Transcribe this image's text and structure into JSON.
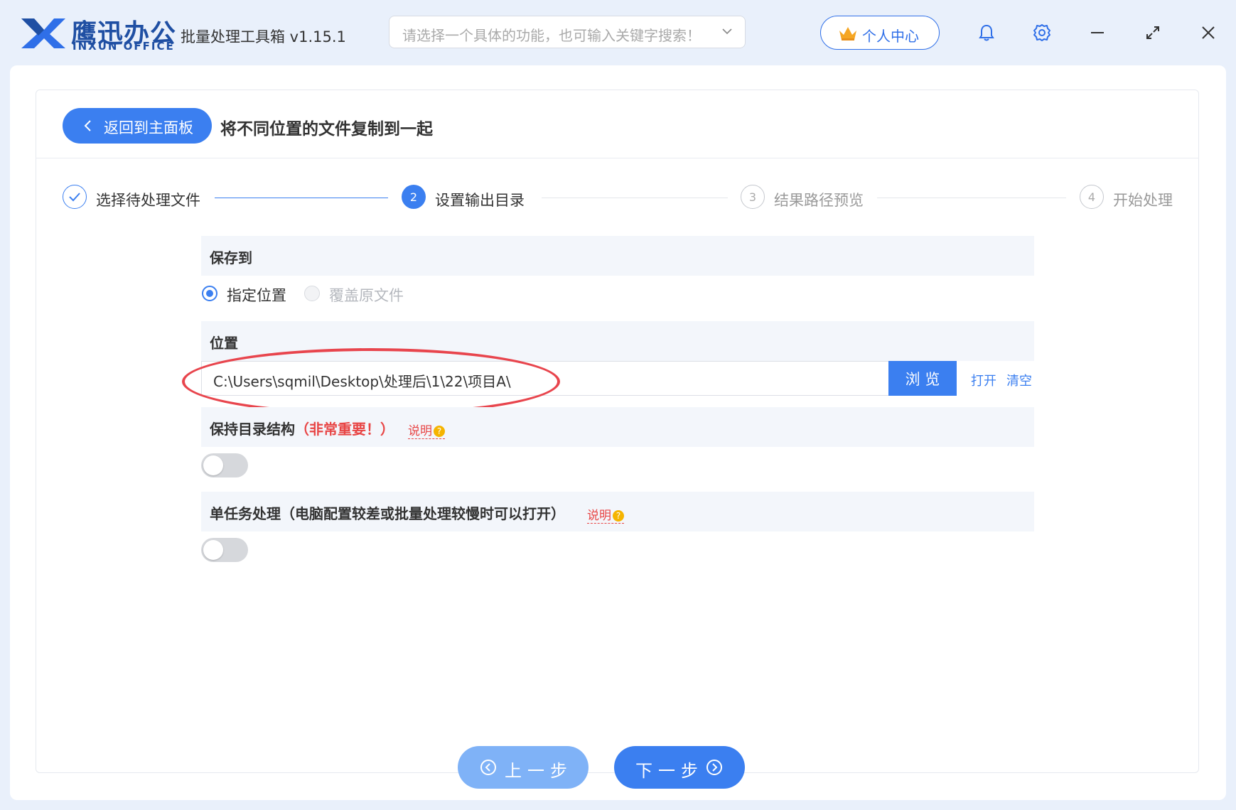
{
  "brand": {
    "name_cn": "鹰迅办公",
    "name_en": "INXUN OFFICE"
  },
  "app": {
    "title": "批量处理工具箱 v1.15.1"
  },
  "search": {
    "placeholder": "请选择一个具体的功能，也可输入关键字搜索！"
  },
  "header": {
    "user_center_label": "个人中心"
  },
  "nav": {
    "back_label": "返回到主面板"
  },
  "page": {
    "title": "将不同位置的文件复制到一起"
  },
  "steps": [
    {
      "number": "1",
      "label": "选择待处理文件",
      "state": "done"
    },
    {
      "number": "2",
      "label": "设置输出目录",
      "state": "active"
    },
    {
      "number": "3",
      "label": "结果路径预览",
      "state": "pending"
    },
    {
      "number": "4",
      "label": "开始处理",
      "state": "pending"
    }
  ],
  "save_to": {
    "heading": "保存到",
    "options": [
      {
        "label": "指定位置",
        "selected": true,
        "disabled": false
      },
      {
        "label": "覆盖原文件",
        "selected": false,
        "disabled": true
      }
    ]
  },
  "location": {
    "heading": "位置",
    "path_value": "C:\\Users\\sqmil\\Desktop\\处理后\\1\\22\\项目A\\",
    "browse_label": "浏 览",
    "open_label": "打开",
    "clear_label": "清空"
  },
  "keep_structure": {
    "heading": "保持目录结构",
    "note": "（非常重要！）",
    "help_label": "说明",
    "enabled": false
  },
  "single_task": {
    "heading": "单任务处理（电脑配置较差或批量处理较慢时可以打开）",
    "help_label": "说明",
    "enabled": false
  },
  "footer": {
    "prev_label": "上一步",
    "next_label": "下一步"
  },
  "colors": {
    "primary": "#3b7ff0",
    "brand": "#1f4fa3",
    "warning": "#e84545"
  }
}
